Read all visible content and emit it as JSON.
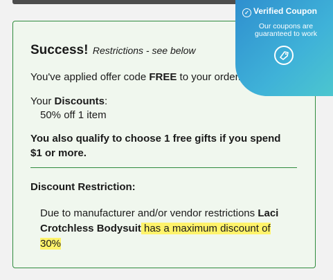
{
  "coupon_badge": {
    "verified_label": "Verified Coupon",
    "note": "Our coupons are guaranteed to work",
    "icon": "tag-icon"
  },
  "success": {
    "heading": "Success!",
    "subheading": "Restrictions - see below"
  },
  "applied": {
    "prefix": "You've applied offer code ",
    "code": "FREE",
    "suffix": " to your order."
  },
  "discounts": {
    "prefix": "Your ",
    "label": "Discounts",
    "suffix": ":",
    "item": "50% off 1 item"
  },
  "qualify": {
    "line1": "You also qualify to choose 1 free gifts if you spend",
    "line2": "$1 or more."
  },
  "restriction": {
    "heading": "Discount Restriction:",
    "prefix": "Due to manufacturer and/or vendor restrictions ",
    "product": "Laci Crotchless Bodysuit",
    "highlight": " has a maximum discount of 30%"
  },
  "colors": {
    "accent_green": "#2e8b3c",
    "panel_bg": "#f0f7ee",
    "highlight": "#fff36b",
    "badge_blue": "#2f8fcf"
  }
}
